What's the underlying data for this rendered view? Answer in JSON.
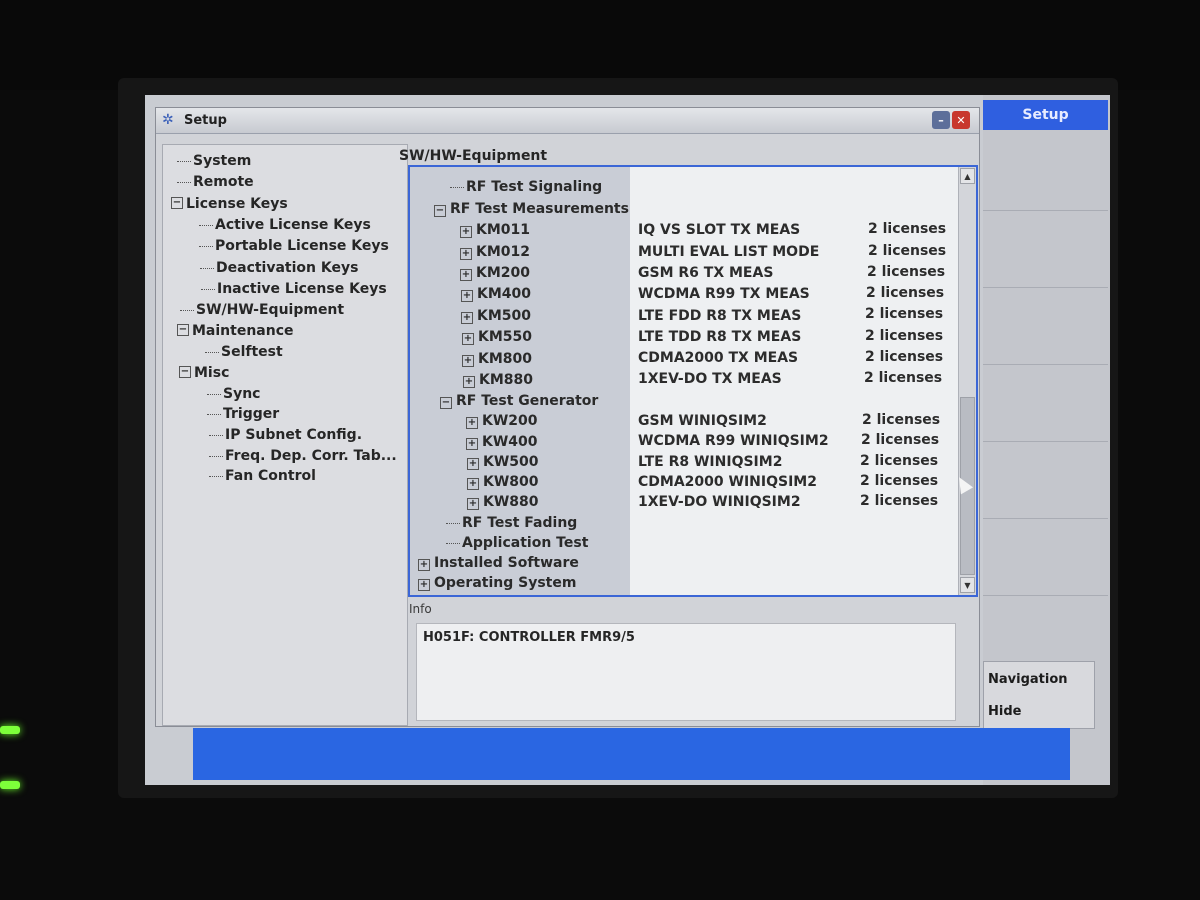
{
  "dialog": {
    "title": "Setup",
    "minimize_glyph": "–",
    "close_glyph": "✕"
  },
  "softkeys": {
    "setup": "Setup",
    "navigation": "Navigation",
    "hide": "Hide"
  },
  "left_tree": [
    {
      "label": "System",
      "expander": ""
    },
    {
      "label": "Remote",
      "expander": ""
    },
    {
      "label": "License Keys",
      "expander": "−"
    },
    {
      "label": "Active License Keys",
      "expander": ""
    },
    {
      "label": "Portable License Keys",
      "expander": ""
    },
    {
      "label": "Deactivation Keys",
      "expander": ""
    },
    {
      "label": "Inactive License Keys",
      "expander": ""
    },
    {
      "label": "SW/HW-Equipment",
      "expander": ""
    },
    {
      "label": "Maintenance",
      "expander": "−"
    },
    {
      "label": "Selftest",
      "expander": ""
    },
    {
      "label": "Misc",
      "expander": "−"
    },
    {
      "label": "Sync",
      "expander": ""
    },
    {
      "label": "Trigger",
      "expander": ""
    },
    {
      "label": "IP Subnet Config.",
      "expander": ""
    },
    {
      "label": "Freq. Dep. Corr. Tab...",
      "expander": ""
    },
    {
      "label": "Fan Control",
      "expander": ""
    }
  ],
  "section_title": "SW/HW-Equipment",
  "equipment_tree": [
    {
      "label": "RF Test Signaling",
      "expander": "",
      "desc": "",
      "licenses": ""
    },
    {
      "label": "RF Test Measurements",
      "expander": "−",
      "desc": "",
      "licenses": ""
    },
    {
      "label": "KM011",
      "expander": "+",
      "desc": "IQ VS SLOT TX MEAS",
      "licenses": "2 licenses"
    },
    {
      "label": "KM012",
      "expander": "+",
      "desc": "MULTI EVAL LIST MODE",
      "licenses": "2 licenses"
    },
    {
      "label": "KM200",
      "expander": "+",
      "desc": "GSM R6 TX MEAS",
      "licenses": "2 licenses"
    },
    {
      "label": "KM400",
      "expander": "+",
      "desc": "WCDMA R99 TX MEAS",
      "licenses": "2 licenses"
    },
    {
      "label": "KM500",
      "expander": "+",
      "desc": "LTE FDD R8 TX MEAS",
      "licenses": "2 licenses"
    },
    {
      "label": "KM550",
      "expander": "+",
      "desc": "LTE TDD R8 TX MEAS",
      "licenses": "2 licenses"
    },
    {
      "label": "KM800",
      "expander": "+",
      "desc": "CDMA2000 TX MEAS",
      "licenses": "2 licenses"
    },
    {
      "label": "KM880",
      "expander": "+",
      "desc": "1XEV-DO TX MEAS",
      "licenses": "2 licenses"
    },
    {
      "label": "RF Test Generator",
      "expander": "−",
      "desc": "",
      "licenses": ""
    },
    {
      "label": "KW200",
      "expander": "+",
      "desc": "GSM WINIQSIM2",
      "licenses": "2 licenses"
    },
    {
      "label": "KW400",
      "expander": "+",
      "desc": "WCDMA R99 WINIQSIM2",
      "licenses": "2 licenses"
    },
    {
      "label": "KW500",
      "expander": "+",
      "desc": "LTE R8 WINIQSIM2",
      "licenses": "2 licenses"
    },
    {
      "label": "KW800",
      "expander": "+",
      "desc": "CDMA2000 WINIQSIM2",
      "licenses": "2 licenses"
    },
    {
      "label": "KW880",
      "expander": "+",
      "desc": "1XEV-DO WINIQSIM2",
      "licenses": "2 licenses"
    },
    {
      "label": "RF Test Fading",
      "expander": "",
      "desc": "",
      "licenses": ""
    },
    {
      "label": "Application Test",
      "expander": "",
      "desc": "",
      "licenses": ""
    },
    {
      "label": "Installed Software",
      "expander": "+",
      "desc": "",
      "licenses": ""
    },
    {
      "label": "Operating System",
      "expander": "+",
      "desc": "",
      "licenses": ""
    }
  ],
  "info": {
    "label": "Info",
    "text": "H051F: CONTROLLER FMR9/5"
  },
  "colors": {
    "screen_blue": "#2a66e2",
    "focus_border": "#3b66d6",
    "softkey_active": "#2f5fe0"
  }
}
